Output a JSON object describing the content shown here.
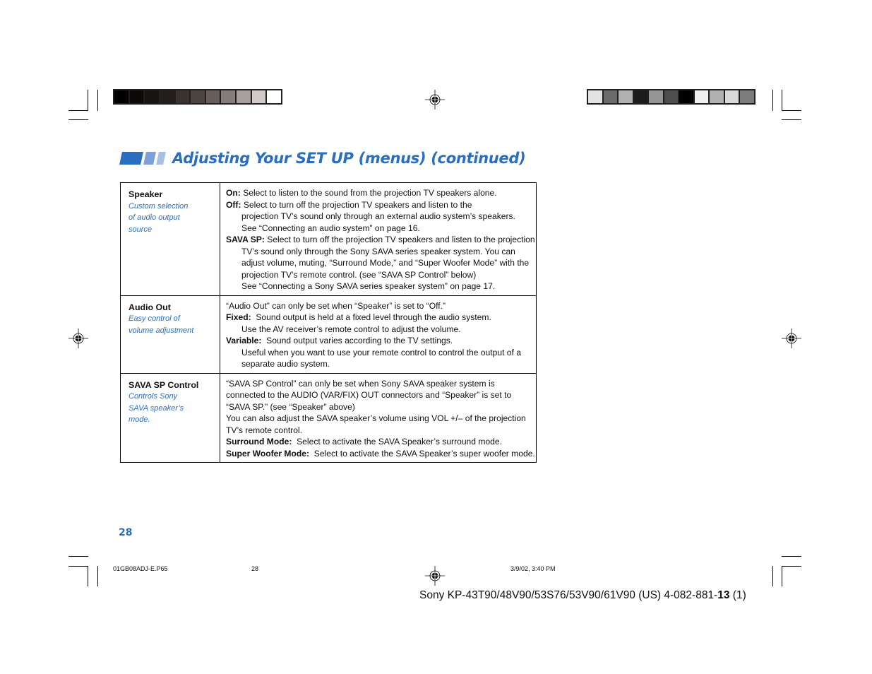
{
  "header": {
    "title": "Adjusting Your SET UP (menus) (continued)",
    "icon": "three-bar-section-icon",
    "accent_color": "#2a6ebf"
  },
  "color_bars": {
    "left": [
      "#000000",
      "#0c0a09",
      "#161312",
      "#211e1c",
      "#39322f",
      "#4c4441",
      "#675e5b",
      "#857d7a",
      "#a8a09e",
      "#d2cbca",
      "#ffffff"
    ],
    "right": [
      "#e3e3e3",
      "#6b6b6b",
      "#b0b0b0",
      "#1c1c1c",
      "#959595",
      "#4e4e4e",
      "#000000",
      "#f0f0f0",
      "#b1b1b1",
      "#d9d9d9",
      "#7c7c7c"
    ]
  },
  "table": {
    "rows": [
      {
        "label": "Speaker",
        "sublabel": [
          "Custom selection",
          "of audio output",
          "source"
        ],
        "lines": [
          {
            "bold": "On:",
            "text": " Select to listen to the sound from the projection TV speakers alone.",
            "indent": false
          },
          {
            "bold": "Off:",
            "text": " Select to turn off the projection TV speakers and listen to the",
            "indent": false
          },
          {
            "bold": "",
            "text": "projection TV’s sound only through an external audio system’s speakers.",
            "indent": true
          },
          {
            "bold": "",
            "text": "See “Connecting an audio system” on page 16.",
            "indent": true
          },
          {
            "bold": "SAVA SP:",
            "text": " Select to turn off the projection TV speakers and listen to the projection",
            "indent": false
          },
          {
            "bold": "",
            "text": "TV’s sound only through the Sony SAVA series speaker system. You can",
            "indent": true
          },
          {
            "bold": "",
            "text": "adjust volume, muting, “Surround Mode,” and “Super Woofer Mode” with the",
            "indent": true
          },
          {
            "bold": "",
            "text": "projection TV’s remote control. (see “SAVA SP Control” below)",
            "indent": true
          },
          {
            "bold": "",
            "text": "See “Connecting a Sony SAVA series speaker system” on page 17.",
            "indent": true
          }
        ]
      },
      {
        "label": "Audio Out",
        "sublabel": [
          "Easy control of",
          "volume adjustment"
        ],
        "lines": [
          {
            "bold": "",
            "text": "“Audio Out” can only be set when “Speaker” is set to “Off.”",
            "indent": false
          },
          {
            "bold": "Fixed:",
            "text": "  Sound output is held at a fixed level through the audio system.",
            "indent": false
          },
          {
            "bold": "",
            "text": "Use the AV receiver’s remote control to adjust the volume.",
            "indent": true
          },
          {
            "bold": "Variable:",
            "text": "  Sound output varies according to the TV settings.",
            "indent": false
          },
          {
            "bold": "",
            "text": "Useful when you want to use your remote control to control the output of a",
            "indent": true
          },
          {
            "bold": "",
            "text": "separate audio system.",
            "indent": true
          }
        ]
      },
      {
        "label": "SAVA SP Control",
        "sublabel": [
          "Controls Sony",
          "SAVA speaker’s",
          "mode."
        ],
        "lines": [
          {
            "bold": "",
            "text": "“SAVA SP Control” can only be set when Sony SAVA speaker system is",
            "indent": false
          },
          {
            "bold": "",
            "text": "connected to the AUDIO (VAR/FIX) OUT connectors and “Speaker” is set to",
            "indent": false
          },
          {
            "bold": "",
            "text": "“SAVA SP.” (see “Speaker” above)",
            "indent": false
          },
          {
            "bold": "",
            "text": "You can also adjust the SAVA speaker’s volume using VOL +/– of the projection",
            "indent": false
          },
          {
            "bold": "",
            "text": "TV’s remote control.",
            "indent": false
          },
          {
            "bold": "Surround Mode:",
            "text": "  Select to activate the SAVA Speaker’s surround mode.",
            "indent": false
          },
          {
            "bold": "Super Woofer Mode:",
            "text": "  Select to activate the SAVA Speaker’s super woofer mode.",
            "indent": false
          }
        ]
      }
    ]
  },
  "page_number": "28",
  "footer": {
    "filename": "01GB08ADJ-E.P65",
    "page": "28",
    "datetime": "3/9/02, 3:40 PM"
  },
  "model_line": {
    "prefix": "Sony KP-43T90/48V90/53S76/53V90/61V90 (US) 4-082-881-",
    "bold": "13",
    "suffix": " (1)"
  }
}
